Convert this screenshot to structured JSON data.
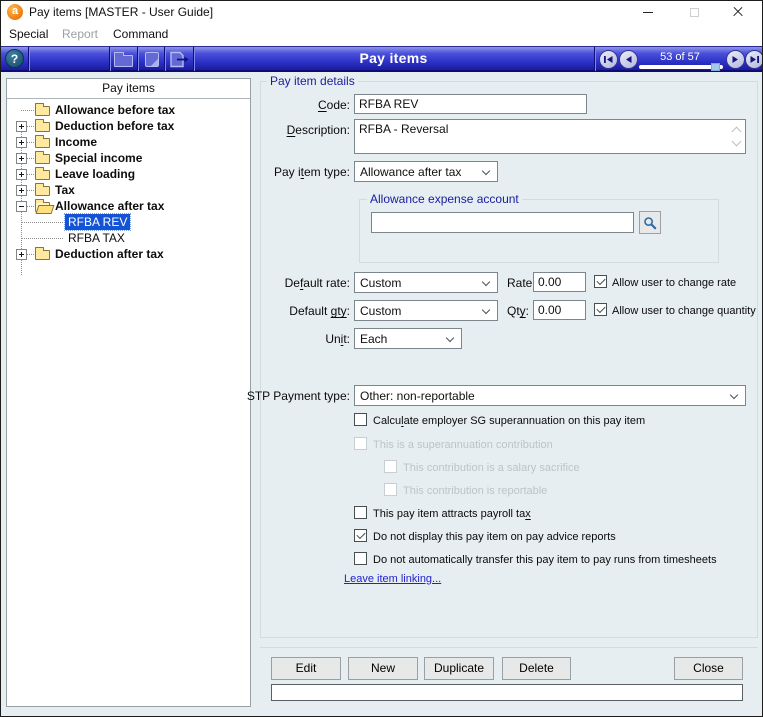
{
  "window": {
    "title": "Pay items [MASTER - User Guide]",
    "icon_letter": "a"
  },
  "menubar": {
    "items": [
      {
        "label": "Special",
        "enabled": true
      },
      {
        "label": "Report",
        "enabled": false
      },
      {
        "label": "Command",
        "enabled": true
      }
    ]
  },
  "toolbar": {
    "help_label": "?",
    "title": "Pay items",
    "nav": {
      "position_text": "53 of 57"
    }
  },
  "icons": {
    "help": "question-mark circle",
    "folder": "folder shape",
    "note": "page with folded corner",
    "export": "page with right arrow",
    "search": "magnifier",
    "nav_first": "bar + left triangle",
    "nav_prev": "left triangle",
    "nav_next": "right triangle",
    "nav_last": "right triangle + bar"
  },
  "tree": {
    "header": "Pay items",
    "items": [
      {
        "label": "Allowance before tax",
        "type": "folder",
        "expand": "none",
        "selected": false
      },
      {
        "label": "Deduction before tax",
        "type": "folder",
        "expand": "plus",
        "selected": false
      },
      {
        "label": "Income",
        "type": "folder",
        "expand": "plus",
        "selected": false
      },
      {
        "label": "Special income",
        "type": "folder",
        "expand": "plus",
        "selected": false
      },
      {
        "label": "Leave loading",
        "type": "folder",
        "expand": "plus",
        "selected": false
      },
      {
        "label": "Tax",
        "type": "folder",
        "expand": "plus",
        "selected": false
      },
      {
        "label": "Allowance after tax",
        "type": "folder-open",
        "expand": "minus",
        "selected": false
      },
      {
        "label": "RFBA REV",
        "type": "leaf",
        "expand": "none",
        "selected": true
      },
      {
        "label": "RFBA TAX",
        "type": "leaf",
        "expand": "none",
        "selected": false
      },
      {
        "label": "Deduction after tax",
        "type": "folder",
        "expand": "plus",
        "selected": false
      }
    ]
  },
  "details": {
    "group_title": "Pay item details",
    "code": {
      "label": {
        "pre": "",
        "u": "C",
        "post": "ode:"
      },
      "value": "RFBA REV"
    },
    "description": {
      "label": {
        "pre": "",
        "u": "D",
        "post": "escription:"
      },
      "value": "RFBA - Reversal"
    },
    "pay_item_type": {
      "label": {
        "pre": "Pay i",
        "u": "t",
        "post": "em type:"
      },
      "value": "Allowance after tax"
    },
    "expense_group": {
      "title": "Allowance expense account",
      "value": ""
    },
    "default_rate": {
      "label": {
        "pre": "De",
        "u": "f",
        "post": "ault rate:"
      },
      "value": "Custom"
    },
    "rate": {
      "label": "Rate",
      "value": "0.00"
    },
    "allow_rate": {
      "label": "Allow user to change rate",
      "checked": true
    },
    "default_qty": {
      "label": {
        "pre": "Default ",
        "u": "gty",
        "post": ":"
      },
      "value": "Custom"
    },
    "qty": {
      "label": {
        "pre": "Qt",
        "u": "y",
        "post": ":"
      },
      "value": "0.00"
    },
    "allow_qty": {
      "label": "Allow user to change quantity",
      "checked": true
    },
    "unit": {
      "label": {
        "pre": "Un",
        "u": "i",
        "post": "t:"
      },
      "value": "Each"
    },
    "stp": {
      "label": "STP Payment type:",
      "value": "Other: non-reportable"
    },
    "checkboxes": [
      {
        "label": {
          "pre": "Calcu",
          "u": "l",
          "post": "ate employer SG superannuation on this pay item"
        },
        "checked": false,
        "disabled": false,
        "indent": 0
      },
      {
        "label": "This is a superannuation contribution",
        "checked": false,
        "disabled": true,
        "indent": 0
      },
      {
        "label": "This contribution is a salary sacrifice",
        "checked": false,
        "disabled": true,
        "indent": 1
      },
      {
        "label": "This contribution is reportable",
        "checked": false,
        "disabled": true,
        "indent": 1
      },
      {
        "label": {
          "pre": "This pay item attracts payroll ta",
          "u": "x",
          "post": ""
        },
        "checked": false,
        "disabled": false,
        "indent": 0
      },
      {
        "label": "Do not display this pay item on pay advice reports",
        "checked": true,
        "disabled": false,
        "indent": 0
      },
      {
        "label": "Do not automatically transfer this pay item to pay runs from timesheets",
        "checked": false,
        "disabled": false,
        "indent": 0
      }
    ],
    "link": "Leave item linking..."
  },
  "footer": {
    "buttons": [
      "Edit",
      "New",
      "Duplicate",
      "Delete"
    ],
    "close": "Close",
    "status_value": ""
  },
  "colors": {
    "toolbar_blue": "#2f33c8",
    "selection_blue": "#1453d5",
    "group_label_navy": "#181d9e",
    "link_blue": "#2323cc",
    "content_bg": "#e7eef1",
    "folder_yellow": "#ffe9a0"
  }
}
